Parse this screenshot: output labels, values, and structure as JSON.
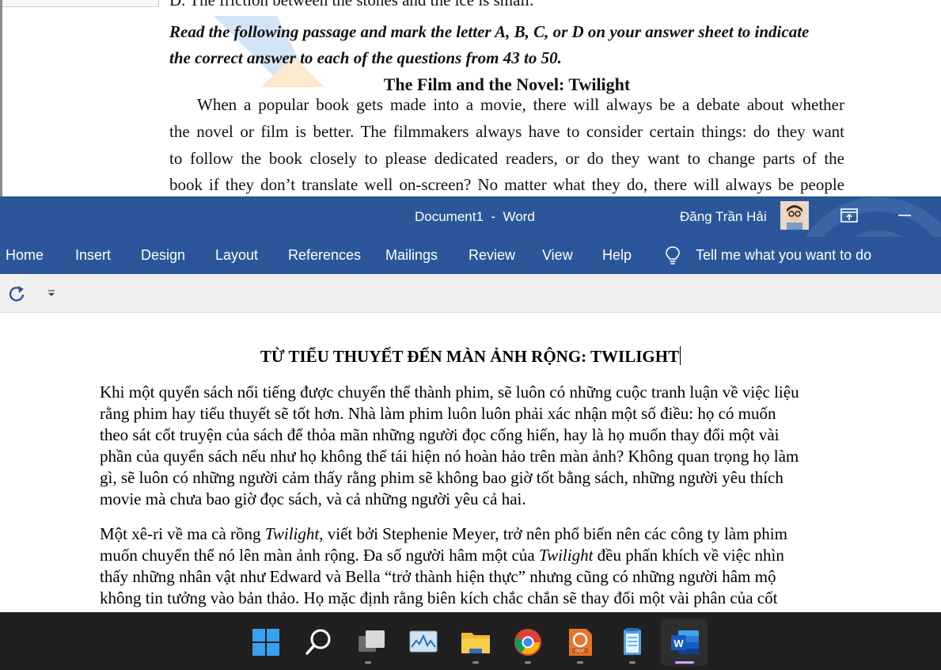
{
  "background_doc": {
    "cut_line": "D. The friction between the stones and the ice is small.",
    "instruction_line1": "Read the following passage and mark the letter A, B, C, or D on your answer sheet to indicate",
    "instruction_line2": "the correct answer to each of the questions from 43 to 50.",
    "title": "The Film and the Novel: Twilight",
    "para_lines": [
      "When a popular book gets made into a movie, there will always be a debate about whether",
      "the novel or film is better. The filmmakers always have to consider certain things: do they want",
      "to follow the book closely to please dedicated readers, or do they want to change parts of the",
      "book if they don’t translate well on-screen? No matter what they do, there will always be people"
    ]
  },
  "titlebar": {
    "doc_title": "Document1  -  Word",
    "user_name": "Đăng Trần Hải"
  },
  "menu": {
    "tabs": [
      "Home",
      "Insert",
      "Design",
      "Layout",
      "References",
      "Mailings",
      "Review",
      "View",
      "Help"
    ],
    "tell_me": "Tell me what you want to do"
  },
  "document": {
    "heading": "TỪ TIỂU THUYẾT ĐẾN MÀN ẢNH RỘNG: TWILIGHT",
    "para1": [
      "Khi một quyển sách nổi tiếng được chuyển thể thành phim, sẽ luôn có những cuộc tranh luận về việc liệu",
      "rằng phim hay tiểu thuyết sẽ tốt hơn. Nhà làm phim luôn luôn phải xác nhận một số điều: họ có muốn",
      "theo sát cốt truyện của sách để thỏa mãn những người đọc cống hiến, hay là họ muốn thay đổi một vài",
      "phần của quyển sách nếu như họ không thể tái hiện nó hoàn hảo trên màn ảnh? Không quan trọng họ làm",
      "gì, sẽ luôn có những người cảm thấy rằng phim sẽ không bao giờ tốt bằng sách, những người yêu thích",
      "movie mà chưa bao giờ đọc sách, và cả những người yêu cả hai."
    ],
    "para2": {
      "l1_a": "Một xê-ri về ma cà rồng ",
      "l1_i": "Twilight,",
      "l1_b": " viết bởi Stephenie Meyer, trở nên phổ biến nên các công ty làm phim",
      "l2_a": "muốn chuyển thể nó lên màn ảnh rộng. Đa số người hâm một của ",
      "l2_i": "Twilight",
      "l2_b": " đều phấn khích về việc nhìn",
      "l3": "thấy những nhân vật như Edward và Bella “trở thành hiện thực” nhưng cũng có những người hâm mộ",
      "l4": "không tin tưởng vào bản thảo. Họ mặc định rằng biên kích chắc chắn sẽ thay đổi một vài phân của cốt"
    }
  },
  "taskbar": {
    "icons": [
      "windows-start-icon",
      "search-icon",
      "task-view-icon",
      "photos-icon",
      "file-explorer-icon",
      "chrome-icon",
      "pdf-reader-icon",
      "notepad-icon",
      "word-icon"
    ]
  },
  "colors": {
    "word_blue": "#2b579a",
    "taskbar": "#202020",
    "qat_bg": "#f0f0f0"
  }
}
